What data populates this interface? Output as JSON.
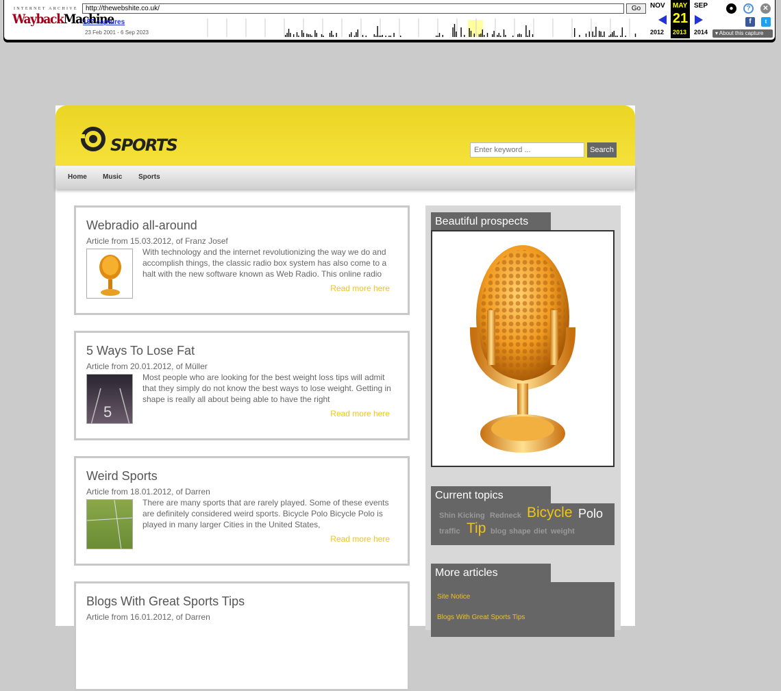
{
  "wayback": {
    "brand_top": "INTERNET ARCHIVE",
    "brand_logo_a": "Wayback",
    "brand_logo_b": "Machine",
    "url": "http://thewebshite.co.uk/",
    "go_label": "Go",
    "captures": "187 captures",
    "date_range": "23 Feb 2001 - 6 Sep 2023",
    "months": {
      "prev": "NOV",
      "cur": "MAY",
      "next": "SEP"
    },
    "day": "21",
    "years": {
      "prev": "2012",
      "cur": "2013",
      "next": "2014"
    },
    "about": "About this capture",
    "colors": {
      "accent": "#a5001a",
      "link": "#2234d6",
      "highlight": "#ffff00"
    }
  },
  "site": {
    "logo_text": "SPORTS",
    "search": {
      "placeholder": "Enter keyword ...",
      "button": "Search"
    },
    "nav": [
      "Home",
      "Music",
      "Sports"
    ],
    "articles": [
      {
        "title": "Webradio all-around",
        "meta": "Article from 15.03.2012, of Franz Josef",
        "excerpt": "With technology and the internet revolutionizing the way we do and accomplish things, the classic radio box system has also come to a halt with the new software known as Web Radio. This online radio",
        "more": "Read more here"
      },
      {
        "title": "5 Ways To Lose Fat",
        "meta": "Article from 20.01.2012, of Müller",
        "excerpt": "Most people who are looking for the best weight loss tips will admit that they simply do not know the best ways to lose weight. Getting in shape is really all about being able to have the right",
        "more": "Read more here"
      },
      {
        "title": "Weird Sports",
        "meta": "Article from 18.01.2012, of Darren",
        "excerpt": "There are many sports that are rarely played. Some of these events are definitely considered weird sports. Bicycle Polo Bicycle Polo is played in many larger Cities in the United States,",
        "more": "Read more here"
      },
      {
        "title": "Blogs With Great Sports Tips",
        "meta": "Article from 16.01.2012, of Darren",
        "excerpt": "",
        "more": ""
      }
    ],
    "sidebar": {
      "prospects_title": "Beautiful prospects",
      "topics_title": "Current topics",
      "topics": [
        "Shin",
        "Kicking",
        "Redneck",
        "Bicycle",
        "Polo",
        "traffic",
        "Tip",
        "blog",
        "shape",
        "diet",
        "weight"
      ],
      "more_title": "More articles",
      "more_links": [
        "Site Notice",
        "Blogs With Great Sports Tips"
      ]
    },
    "colors": {
      "header": "#f0dc32",
      "accent": "#f0c419",
      "box": "#666666"
    }
  }
}
